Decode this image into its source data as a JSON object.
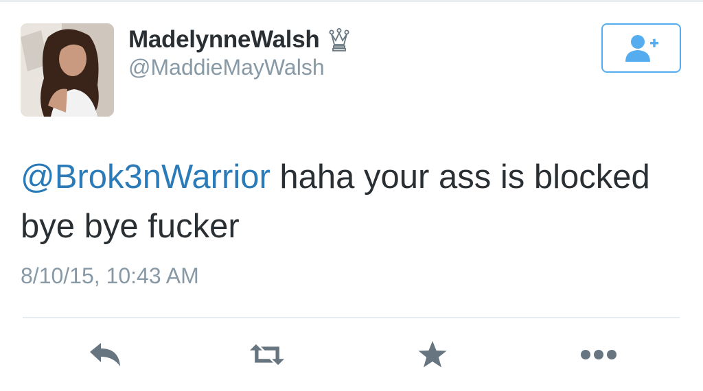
{
  "tweet": {
    "author": {
      "display_name": "MadelynneWalsh",
      "handle": "@MaddieMayWalsh",
      "badge_icon": "crown-icon",
      "avatar_icon": "profile-photo"
    },
    "mention": "@Brok3nWarrior",
    "text": "haha your ass is blocked bye bye fucker",
    "timestamp": "8/10/15, 10:43 AM"
  },
  "follow_button": {
    "icon": "follow-user-icon"
  },
  "actions": [
    {
      "name": "reply",
      "icon": "reply-icon"
    },
    {
      "name": "retweet",
      "icon": "retweet-icon"
    },
    {
      "name": "favorite",
      "icon": "star-icon"
    },
    {
      "name": "more",
      "icon": "more-icon"
    }
  ],
  "colors": {
    "accent": "#55acee",
    "link": "#2b7bb9",
    "text": "#292f33",
    "muted": "#8899a6",
    "icon_gray": "#8899a6"
  }
}
